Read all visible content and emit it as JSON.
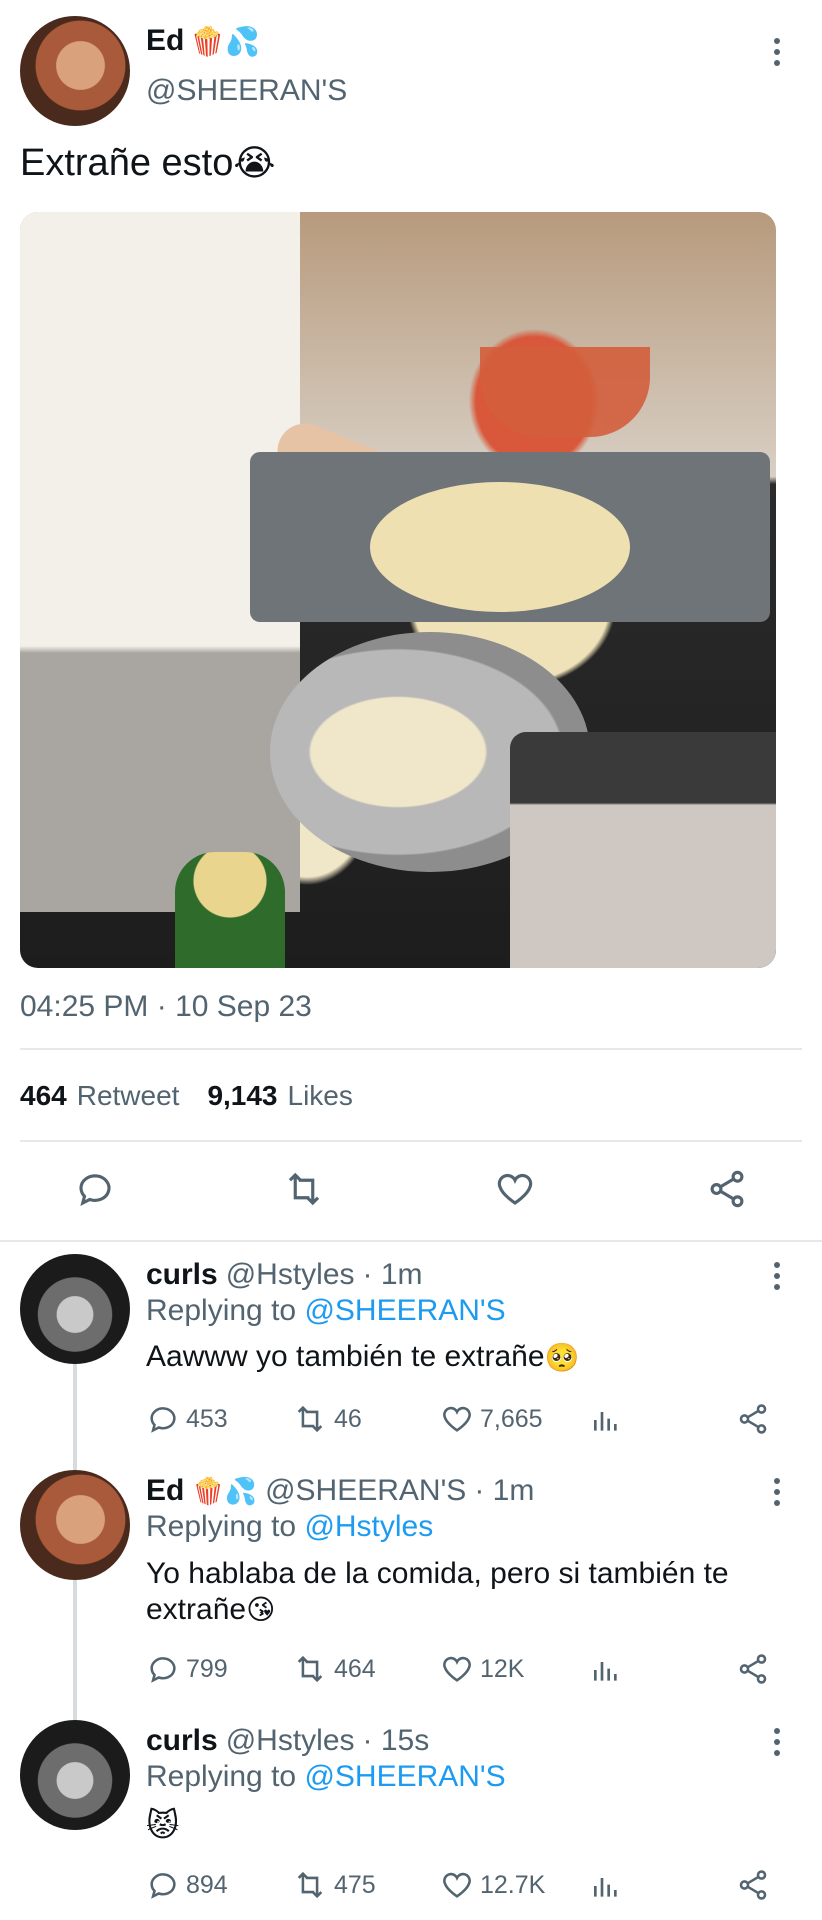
{
  "main_tweet": {
    "name": "Ed",
    "name_emojis": "🍿💦",
    "handle": "@SHEERAN'S",
    "text": "Extrañe esto",
    "text_emoji": "😭",
    "timestamp": "04:25 PM · 10 Sep 23",
    "retweets_count": "464",
    "retweets_label": "Retweet",
    "likes_count": "9,143",
    "likes_label": "Likes"
  },
  "replies": [
    {
      "name": "curls",
      "handle": "@Hstyles",
      "time": "· 1m",
      "replying_prefix": "Replying to",
      "replying_to": "@SHEERAN'S",
      "text": "Aawww yo también te extrañe",
      "text_emoji": "🥺",
      "comments": "453",
      "retweets": "46",
      "likes": "7,665"
    },
    {
      "name": "Ed",
      "name_emojis": "🍿💦",
      "handle": "@SHEERAN'S",
      "time": "· 1m",
      "replying_prefix": "Replying to",
      "replying_to": "@Hstyles",
      "text_line1": "Yo hablaba de la comida, pero si también te",
      "text_line2": "extrañe",
      "text_emoji": "😘",
      "comments": "799",
      "retweets": "464",
      "likes": "12K"
    },
    {
      "name": "curls",
      "handle": "@Hstyles",
      "time": "· 15s",
      "replying_prefix": "Replying to",
      "replying_to": "@SHEERAN'S",
      "text_emoji": "😾",
      "comments": "894",
      "retweets": "475",
      "likes": "12.7K"
    }
  ],
  "colors": {
    "link": "#1d9bf0",
    "secondary_text": "#536471",
    "divider": "#e6e9eb"
  }
}
